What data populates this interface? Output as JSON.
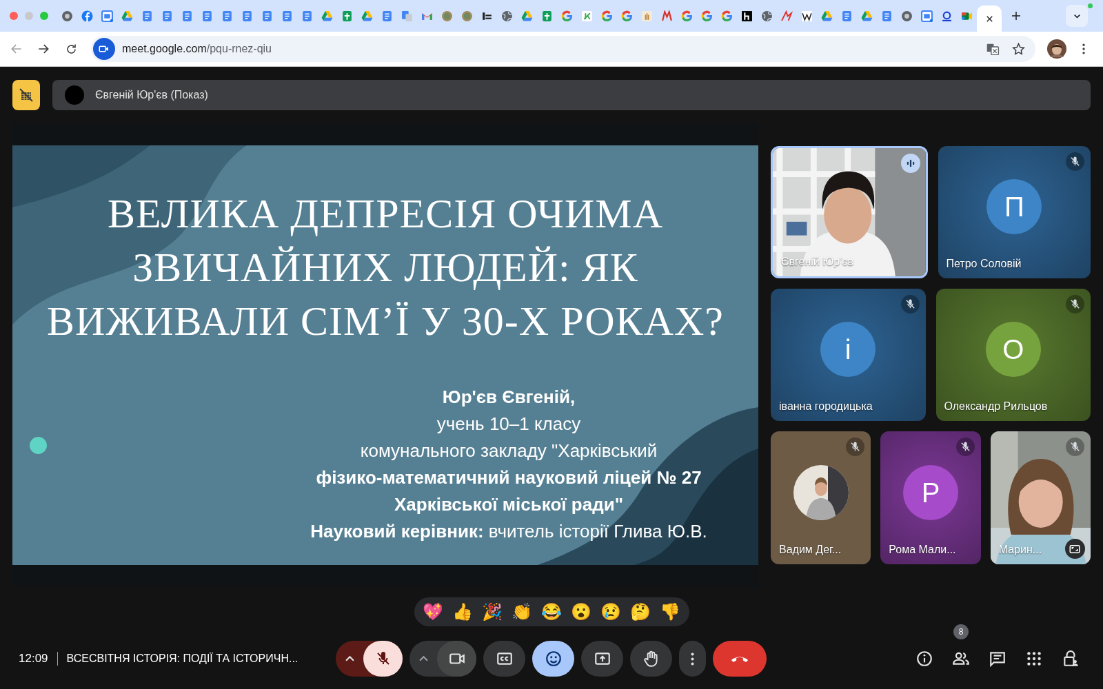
{
  "browser": {
    "url": {
      "host": "meet.google.com",
      "path": "/pqu-rnez-qiu"
    }
  },
  "presenter_bar": {
    "label": "Євгеній Юр'єв (Показ)"
  },
  "slide": {
    "title_lines": [
      "ВЕЛИКА ДЕПРЕСІЯ ОЧИМА",
      "ЗВИЧАЙНИХ ЛЮДЕЙ: ЯК",
      "ВИЖИВАЛИ СІМ’Ї У 30-Х РОКАХ?"
    ],
    "author_lines": [
      {
        "text": "Юр'єв Євгеній,",
        "bold": true
      },
      {
        "text": "учень 10–1 класу",
        "bold": false
      },
      {
        "text": "комунального закладу \"Харківський",
        "bold": false
      },
      {
        "text": "фізико-математичний науковий ліцей № 27",
        "bold": true
      },
      {
        "text": "Харківської міської ради\"",
        "bold": true
      },
      {
        "text": "**Науковий керівник:** вчитель історії Глива Ю.В.",
        "bold": false
      }
    ]
  },
  "participants": [
    {
      "name": "Євгеній Юр'єв",
      "kind": "video",
      "speaking": true,
      "muted": false,
      "expand_button": false
    },
    {
      "name": "Петро Соловій",
      "kind": "avatar",
      "initial": "П",
      "color": "#3d85c6",
      "speaking": false,
      "muted": true
    },
    {
      "name": "іванна городицька",
      "kind": "avatar",
      "initial": "і",
      "color": "#3d85c6",
      "speaking": false,
      "muted": true
    },
    {
      "name": "Олександр Рильцов",
      "kind": "avatar",
      "initial": "О",
      "color": "#77a33f",
      "speaking": false,
      "muted": true
    },
    {
      "name": "Вадим Дег...",
      "kind": "photo_avatar",
      "color": "#6d5b45",
      "speaking": false,
      "muted": true
    },
    {
      "name": "Рома Мали...",
      "kind": "avatar",
      "initial": "Р",
      "color": "#a64bc9",
      "speaking": false,
      "muted": true
    },
    {
      "name": "Марин...",
      "kind": "video",
      "speaking": false,
      "muted": true,
      "expand_button": true
    }
  ],
  "reactions": [
    "💖",
    "👍",
    "🎉",
    "👏",
    "😂",
    "😮",
    "😢",
    "🤔",
    "👎"
  ],
  "meeting": {
    "time": "12:09",
    "title": "ВСЕСВІТНЯ ІСТОРІЯ: ПОДІЇ ТА ІСТОРИЧН..."
  },
  "controls": [
    {
      "kind": "mic",
      "on": false
    },
    {
      "kind": "camera",
      "on": true
    },
    {
      "kind": "captions",
      "selected": false
    },
    {
      "kind": "reactions",
      "selected": true
    },
    {
      "kind": "present",
      "selected": false
    },
    {
      "kind": "raise_hand",
      "selected": false
    },
    {
      "kind": "more"
    },
    {
      "kind": "leave"
    }
  ],
  "side_buttons": [
    {
      "kind": "info"
    },
    {
      "kind": "people",
      "badge": "8"
    },
    {
      "kind": "chat"
    },
    {
      "kind": "activities"
    },
    {
      "kind": "host_controls"
    }
  ]
}
